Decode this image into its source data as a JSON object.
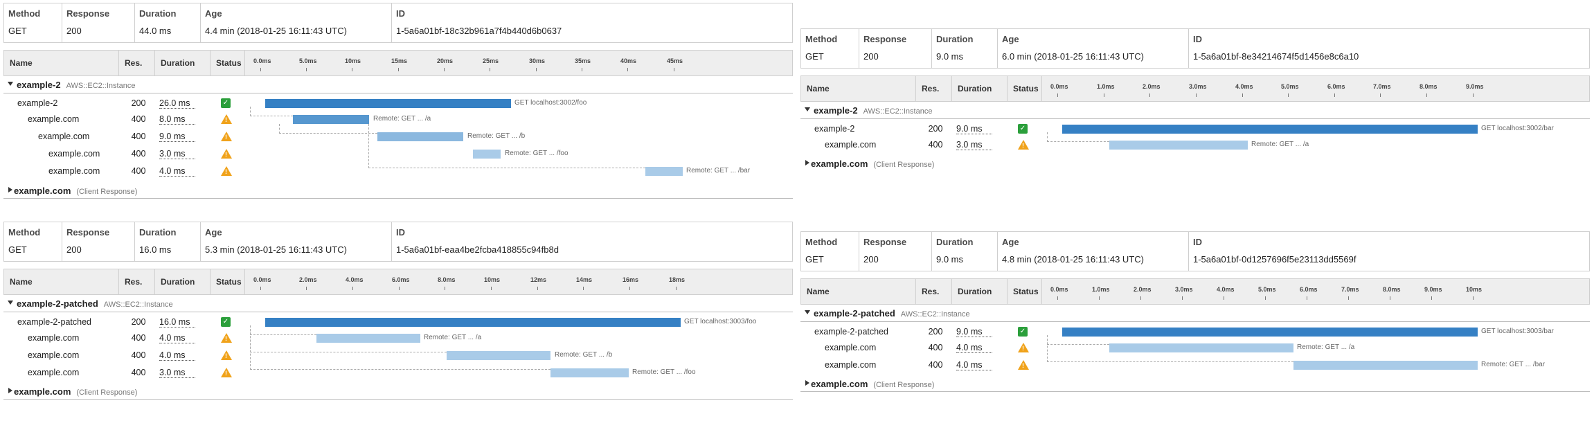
{
  "labels": {
    "method": "Method",
    "response": "Response",
    "duration": "Duration",
    "age": "Age",
    "id": "ID",
    "name": "Name",
    "res": "Res.",
    "status": "Status"
  },
  "colors": {
    "bar_main": "#3580c4",
    "bar_sub": "#a9cbe8",
    "ok": "#2b9f3b",
    "warn": "#f0a21a"
  },
  "traces": [
    {
      "method": "GET",
      "response": "200",
      "duration": "44.0 ms",
      "age": "4.4 min (2018-01-25 16:11:43 UTC)",
      "id": "1-5a6a01bf-18c32b961a7f4b440d6b0637",
      "ticks": [
        "0.0ms",
        "5.0ms",
        "10ms",
        "15ms",
        "20ms",
        "25ms",
        "30ms",
        "35ms",
        "40ms",
        "45ms"
      ],
      "group": {
        "name": "example-2",
        "type": "AWS::EC2::Instance"
      },
      "rows": [
        {
          "name": "example-2",
          "res": "200",
          "dur": "26.0 ms",
          "status": "ok",
          "label": "GET localhost:3002/foo"
        },
        {
          "name": "example.com",
          "res": "400",
          "dur": "8.0 ms",
          "status": "warn",
          "label": "Remote: GET ... /a"
        },
        {
          "name": "example.com",
          "res": "400",
          "dur": "9.0 ms",
          "status": "warn",
          "label": "Remote: GET ... /b"
        },
        {
          "name": "example.com",
          "res": "400",
          "dur": "3.0 ms",
          "status": "warn",
          "label": "Remote: GET ... /foo"
        },
        {
          "name": "example.com",
          "res": "400",
          "dur": "4.0 ms",
          "status": "warn",
          "label": "Remote: GET ... /bar"
        }
      ],
      "client": {
        "name": "example.com",
        "type": "(Client Response)"
      }
    },
    {
      "method": "GET",
      "response": "200",
      "duration": "16.0 ms",
      "age": "5.3 min (2018-01-25 16:11:43 UTC)",
      "id": "1-5a6a01bf-eaa4be2fcba418855c94fb8d",
      "ticks": [
        "0.0ms",
        "2.0ms",
        "4.0ms",
        "6.0ms",
        "8.0ms",
        "10ms",
        "12ms",
        "14ms",
        "16ms",
        "18ms"
      ],
      "group": {
        "name": "example-2-patched",
        "type": "AWS::EC2::Instance"
      },
      "rows": [
        {
          "name": "example-2-patched",
          "res": "200",
          "dur": "16.0 ms",
          "status": "ok",
          "label": "GET localhost:3003/foo"
        },
        {
          "name": "example.com",
          "res": "400",
          "dur": "4.0 ms",
          "status": "warn",
          "label": "Remote: GET ... /a"
        },
        {
          "name": "example.com",
          "res": "400",
          "dur": "4.0 ms",
          "status": "warn",
          "label": "Remote: GET ... /b"
        },
        {
          "name": "example.com",
          "res": "400",
          "dur": "3.0 ms",
          "status": "warn",
          "label": "Remote: GET ... /foo"
        }
      ],
      "client": {
        "name": "example.com",
        "type": "(Client Response)"
      }
    },
    {
      "method": "GET",
      "response": "200",
      "duration": "9.0 ms",
      "age": "6.0 min (2018-01-25 16:11:43 UTC)",
      "id": "1-5a6a01bf-8e34214674f5d1456e8c6a10",
      "ticks": [
        "0.0ms",
        "1.0ms",
        "2.0ms",
        "3.0ms",
        "4.0ms",
        "5.0ms",
        "6.0ms",
        "7.0ms",
        "8.0ms",
        "9.0ms"
      ],
      "group": {
        "name": "example-2",
        "type": "AWS::EC2::Instance"
      },
      "rows": [
        {
          "name": "example-2",
          "res": "200",
          "dur": "9.0 ms",
          "status": "ok",
          "label": "GET localhost:3002/bar"
        },
        {
          "name": "example.com",
          "res": "400",
          "dur": "3.0 ms",
          "status": "warn",
          "label": "Remote: GET ... /a"
        }
      ],
      "client": {
        "name": "example.com",
        "type": "(Client Response)"
      }
    },
    {
      "method": "GET",
      "response": "200",
      "duration": "9.0 ms",
      "age": "4.8 min (2018-01-25 16:11:43 UTC)",
      "id": "1-5a6a01bf-0d1257696f5e23113dd5569f",
      "ticks": [
        "0.0ms",
        "1.0ms",
        "2.0ms",
        "3.0ms",
        "4.0ms",
        "5.0ms",
        "6.0ms",
        "7.0ms",
        "8.0ms",
        "9.0ms",
        "10ms"
      ],
      "group": {
        "name": "example-2-patched",
        "type": "AWS::EC2::Instance"
      },
      "rows": [
        {
          "name": "example-2-patched",
          "res": "200",
          "dur": "9.0 ms",
          "status": "ok",
          "label": "GET localhost:3003/bar"
        },
        {
          "name": "example.com",
          "res": "400",
          "dur": "4.0 ms",
          "status": "warn",
          "label": "Remote: GET ... /a"
        },
        {
          "name": "example.com",
          "res": "400",
          "dur": "4.0 ms",
          "status": "warn",
          "label": "Remote: GET ... /bar"
        }
      ],
      "client": {
        "name": "example.com",
        "type": "(Client Response)"
      }
    }
  ]
}
